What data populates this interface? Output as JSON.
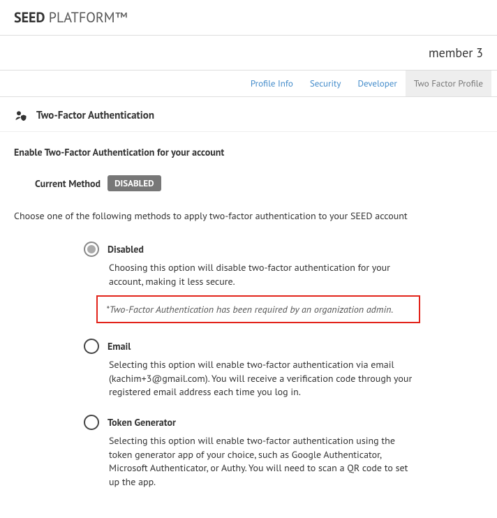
{
  "brand": {
    "bold": "SEED",
    "light": " PLATFORM",
    "tm": "™"
  },
  "user": "member 3",
  "tabs": {
    "profile": "Profile Info",
    "security": "Security",
    "developer": "Developer",
    "twofactor": "Two Factor Profile"
  },
  "section_title": "Two-Factor Authentication",
  "enable_heading": "Enable Two-Factor Authentication for your account",
  "current": {
    "label": "Current Method",
    "value": "DISABLED"
  },
  "intro": "Choose one of the following methods to apply two-factor authentication to your SEED account",
  "options": {
    "disabled": {
      "label": "Disabled",
      "desc": "Choosing this option will disable two-factor authentication for your account, making it less secure.",
      "warn": "*Two-Factor Authentication has been required by an organization admin."
    },
    "email": {
      "label": "Email",
      "desc": "Selecting this option will enable two-factor authentication via email (kachim+3@gmail.com). You will receive a verification code through your registered email address each time you log in."
    },
    "token": {
      "label": "Token Generator",
      "desc": "Selecting this option will enable two-factor authentication using the token generator app of your choice, such as Google Authenticator, Microsoft Authenticator, or Authy. You will need to scan a QR code to set up the app."
    }
  }
}
